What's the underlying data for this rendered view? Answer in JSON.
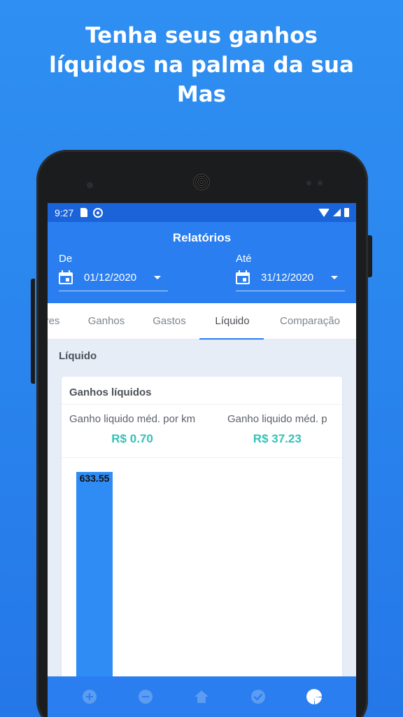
{
  "headline": [
    "Tenha seus ganhos",
    "líquidos na palma da sua",
    "Mas"
  ],
  "status_bar": {
    "time": "9:27"
  },
  "app": {
    "title": "Relatórios",
    "from": {
      "label": "De",
      "value": "01/12/2020"
    },
    "to": {
      "label": "Até",
      "value": "31/12/2020"
    },
    "tabs": [
      "res",
      "Ganhos",
      "Gastos",
      "Líquido",
      "Comparação"
    ],
    "active_tab": "Líquido",
    "accent_color": "#2a7ef0",
    "value_color": "#34c2b7"
  },
  "section_title": "Líquido",
  "card": {
    "title": "Ganhos líquidos",
    "metrics": [
      {
        "label": "Ganho liquido méd. por km",
        "value": "R$ 0.70"
      },
      {
        "label": "Ganho liquido méd. p",
        "value": "R$ 37.23"
      }
    ]
  },
  "chart_data": {
    "type": "bar",
    "categories": [
      ""
    ],
    "values": [
      633.55
    ],
    "data_labels": [
      "633.55"
    ],
    "color": "#2f8cf4",
    "ylim": [
      0,
      633.55
    ]
  },
  "bottom_nav": [
    "add-circle-icon",
    "remove-circle-icon",
    "home-icon",
    "check-circle-icon",
    "pie-chart-icon"
  ]
}
